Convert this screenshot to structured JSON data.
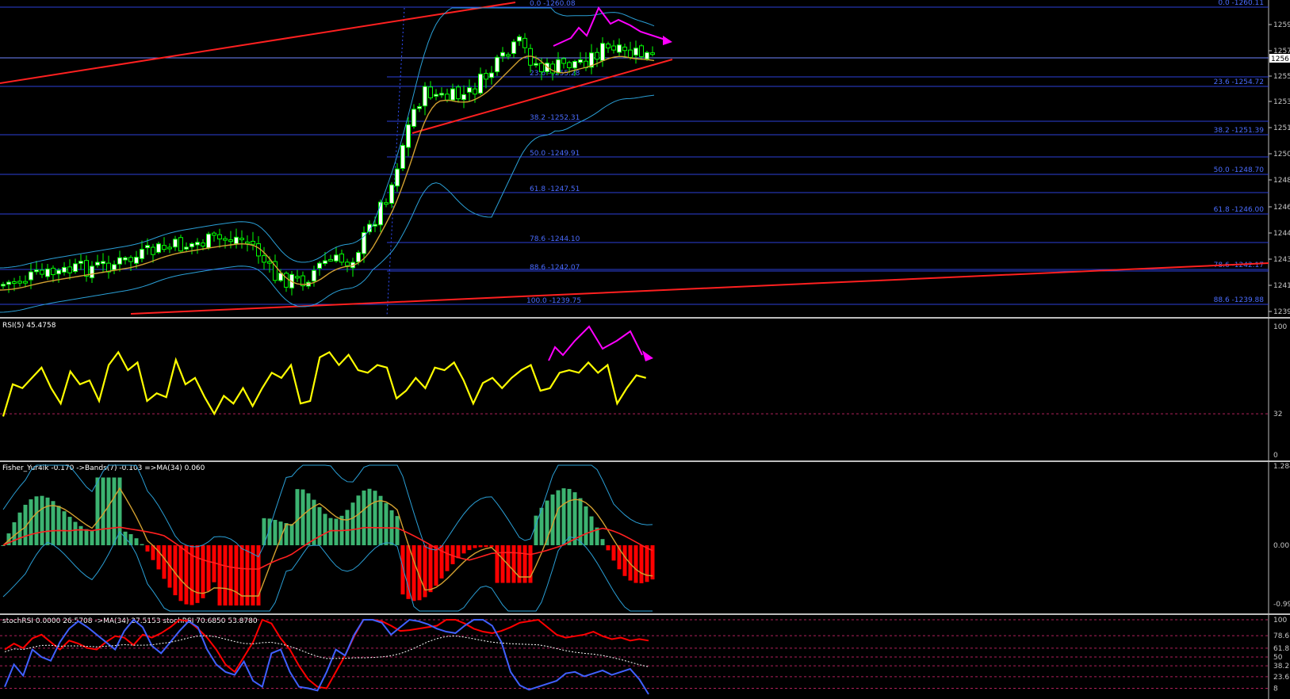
{
  "colors": {
    "background": "#000000",
    "axis_text": "#c8c8c8",
    "candle_up": "#00ff00",
    "candle_up_body": "#ffffff",
    "candle_down": "#00ff00",
    "bands": "#2a9fd6",
    "ma": "#d2a030",
    "trendline": "#ff2020",
    "fib": "#2c3fd9",
    "fib_label": "#4a6cff",
    "annotation": "#ff00ff",
    "rsi": "#ffff00",
    "level": "#b0205a",
    "fisher_pos": "#3cb371",
    "fisher_neg": "#ff0000",
    "fisher_ma": "#ff2020",
    "fisher_sig": "#d2a030",
    "stoch_k": "#ff0000",
    "stoch_d": "#4060ff",
    "stoch_ma": "#ffffff"
  },
  "chart_data": [
    {
      "type": "candlestick",
      "title": "",
      "y_ticks": [
        "1259",
        "1257",
        "1255",
        "1253",
        "1251",
        "1250",
        "1248",
        "1246",
        "1244",
        "1243",
        "1241",
        "1239"
      ],
      "current_price_label": "1256",
      "fib_right_labels": [
        "0.0 -1260.11",
        "23.6 -1254.72",
        "38.2 -1251.39",
        "50.0 -1248.70",
        "61.8 -1246.00",
        "78.6 -1242.17",
        "88.6 -1239.88"
      ],
      "fib_inner_labels": [
        "0.0 -1260.08",
        "23.6 -1255.28",
        "38.2 -1252.31",
        "50.0 -1249.91",
        "61.8 -1247.51",
        "78.6 -1244.10",
        "88.6 -1242.07",
        "100.0 -1239.75"
      ]
    },
    {
      "type": "line",
      "title": "RSI(5) 45.4758",
      "y_ticks": [
        "100",
        "32",
        "0"
      ],
      "level": 32
    },
    {
      "type": "histogram",
      "title": "Fisher_Yur4ik -0.170  ->Bands(7) -0.103  =>MA(34) 0.060",
      "y_ticks": [
        "1.284",
        "0.00",
        "-0.99"
      ]
    },
    {
      "type": "line",
      "title": "stochRSI 0.0000 26.5708  ->MA(34) 27.5153  stochRSI 70.6850 53.8780",
      "y_ticks": [
        "100",
        "78.6",
        "61.8",
        "50",
        "38.2",
        "23.6",
        "8"
      ],
      "levels": [
        100,
        78.6,
        61.8,
        50,
        38.2,
        23.6,
        8
      ]
    }
  ]
}
